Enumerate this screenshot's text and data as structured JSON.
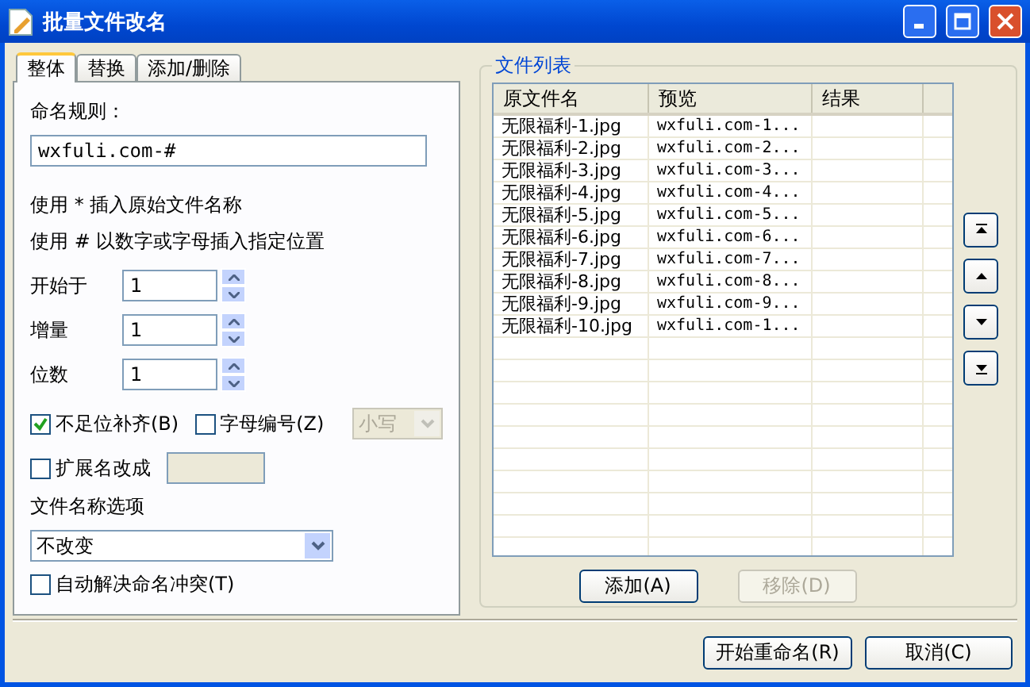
{
  "window": {
    "title": "批量文件改名"
  },
  "tabs": [
    {
      "label": "整体",
      "selected": true
    },
    {
      "label": "替换",
      "selected": false
    },
    {
      "label": "添加/删除",
      "selected": false
    }
  ],
  "naming_rule": {
    "label": "命名规则：",
    "value": "wxfuli.com-#"
  },
  "hints": [
    "使用 * 插入原始文件名称",
    "使用 # 以数字或字母插入指定位置"
  ],
  "spinners": [
    {
      "label": "开始于",
      "value": "1"
    },
    {
      "label": "增量",
      "value": "1"
    },
    {
      "label": "位数",
      "value": "1"
    }
  ],
  "pad_checkbox": {
    "label": "不足位补齐(B)",
    "checked": true
  },
  "letter_checkbox": {
    "label": "字母编号(Z)",
    "checked": false
  },
  "case_select": {
    "value": "小写",
    "disabled": true
  },
  "ext_checkbox": {
    "label": "扩展名改成",
    "checked": false
  },
  "name_options": {
    "label": "文件名称选项",
    "value": "不改变"
  },
  "conflict_checkbox": {
    "label": "自动解决命名冲突(T)",
    "checked": false
  },
  "file_list": {
    "title": "文件列表",
    "columns": [
      "原文件名",
      "预览",
      "结果"
    ],
    "rows": [
      {
        "original": "无限福利-1.jpg",
        "preview": "wxfuli.com-1..."
      },
      {
        "original": "无限福利-2.jpg",
        "preview": "wxfuli.com-2..."
      },
      {
        "original": "无限福利-3.jpg",
        "preview": "wxfuli.com-3..."
      },
      {
        "original": "无限福利-4.jpg",
        "preview": "wxfuli.com-4..."
      },
      {
        "original": "无限福利-5.jpg",
        "preview": "wxfuli.com-5..."
      },
      {
        "original": "无限福利-6.jpg",
        "preview": "wxfuli.com-6..."
      },
      {
        "original": "无限福利-7.jpg",
        "preview": "wxfuli.com-7..."
      },
      {
        "original": "无限福利-8.jpg",
        "preview": "wxfuli.com-8..."
      },
      {
        "original": "无限福利-9.jpg",
        "preview": "wxfuli.com-9..."
      },
      {
        "original": "无限福利-10.jpg",
        "preview": "wxfuli.com-1..."
      }
    ],
    "buttons": [
      {
        "label": "添加(A)",
        "disabled": false
      },
      {
        "label": "移除(D)",
        "disabled": true
      }
    ]
  },
  "move_buttons": [
    {
      "kind": "top"
    },
    {
      "kind": "up"
    },
    {
      "kind": "down"
    },
    {
      "kind": "bottom"
    }
  ],
  "dialog_buttons": [
    "开始重命名(R)",
    "取消(C)"
  ]
}
